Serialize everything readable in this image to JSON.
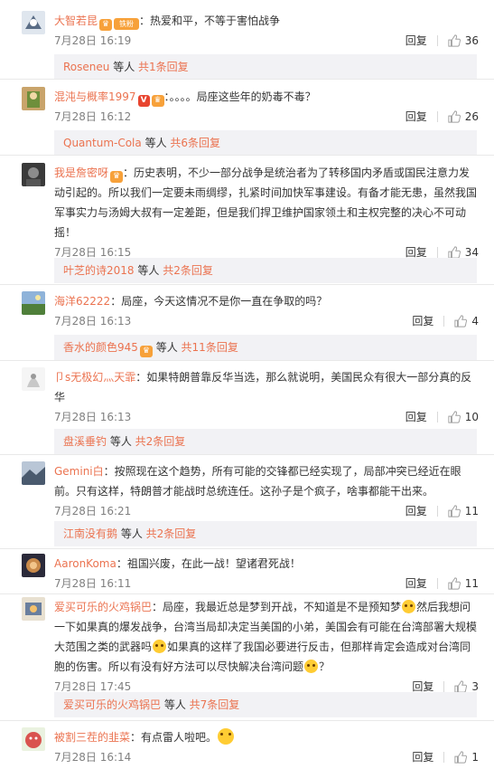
{
  "colors": {
    "accent": "#eb7350",
    "muted": "#808080",
    "sub_bg": "#f2f2f5"
  },
  "comments": [
    {
      "author": "大智若昆",
      "badges": [
        "crown",
        "铁粉"
      ],
      "text": "热爱和平，不等于害怕战争",
      "time": "7月28日 16:19",
      "reply_label": "回复",
      "likes": "36",
      "sub_user": "Roseneu",
      "sub_mid": " 等人 ",
      "sub_link": "共1条回复"
    },
    {
      "author": "混沌与概率1997",
      "badges": [
        "V",
        "crown"
      ],
      "text": "。。。。局座这些年的奶毒不毒？",
      "time": "7月28日 16:12",
      "reply_label": "回复",
      "likes": "26",
      "sub_user": "Quantum-Cola",
      "sub_mid": " 等人 ",
      "sub_link": "共6条回复"
    },
    {
      "author": "我是詹密呀",
      "badges": [
        "crown"
      ],
      "text": "历史表明，不少一部分战争是统治者为了转移国内矛盾或国民注意力发动引起的。所以我们一定要未雨绸缪，扎紧时间加快军事建设。有备才能无患，虽然我国军事实力与汤姆大叔有一定差距，但是我们捍卫维护国家领土和主权完整的决心不可动摇！",
      "time": "7月28日 16:15",
      "reply_label": "回复",
      "likes": "34",
      "sub_user": "叶芝的诗2018",
      "sub_mid": " 等人 ",
      "sub_link": "共2条回复"
    },
    {
      "author": "海洋62222",
      "badges": [],
      "text": "局座，今天这情况不是你一直在争取的吗？",
      "time": "7月28日 16:13",
      "reply_label": "回复",
      "likes": "4",
      "sub_user": "香水的颜色945",
      "sub_badge": "crown",
      "sub_mid": " 等人 ",
      "sub_link": "共11条回复"
    },
    {
      "author": "卩s无极幻灬天霏",
      "badges": [],
      "text": "如果特朗普靠反华当选，那么就说明，美国民众有很大一部分真的反华",
      "time": "7月28日 16:13",
      "reply_label": "回复",
      "likes": "10",
      "sub_user": "盘溪垂钓",
      "sub_mid": " 等人 ",
      "sub_link": "共2条回复"
    },
    {
      "author": "Gemini白",
      "badges": [],
      "text": "按照现在这个趋势，所有可能的交锋都已经实现了，局部冲突已经近在眼前。只有这样，特朗普才能战时总统连任。这孙子是个疯子，啥事都能干出来。",
      "time": "7月28日 16:21",
      "reply_label": "回复",
      "likes": "11",
      "sub_user": "江南没有鹅",
      "sub_mid": " 等人 ",
      "sub_link": "共2条回复"
    },
    {
      "author": "AaronKoma",
      "badges": [],
      "text": "祖国兴废，在此一战！望诸君死战！",
      "time": "7月28日 16:11",
      "reply_label": "回复",
      "likes": "11"
    },
    {
      "author": "爱买可乐的火鸡锅巴",
      "badges": [],
      "text_parts": [
        "局座，我最近总是梦到开战，不知道是不是预知梦",
        "然后我想问一下如果真的爆发战争，台湾当局却决定当美国的小弟，美国会有可能在台湾部署大规模大范围之类的武器吗",
        "如果真的这样了我国必要进行反击，但那样肯定会造成对台湾同胞的伤害。所以有没有好方法可以尽快解决台湾问题",
        "？"
      ],
      "time": "7月28日 17:45",
      "reply_label": "回复",
      "likes": "3",
      "sub_user": "爱买可乐的火鸡锅巴",
      "sub_mid": " 等人 ",
      "sub_link": "共7条回复"
    },
    {
      "author": "被割三茬的韭菜",
      "badges": [],
      "text": "有点雷人啦吧。",
      "time": "7月28日 16:14",
      "reply_label": "回复",
      "likes": "1"
    }
  ]
}
